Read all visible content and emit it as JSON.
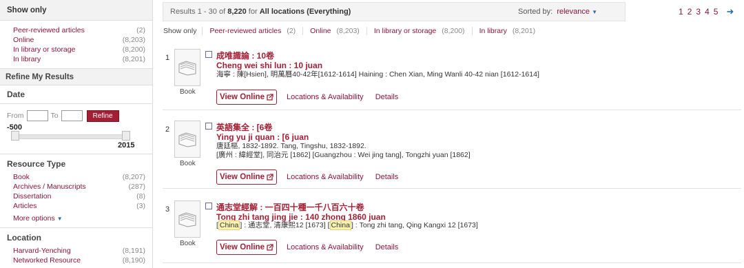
{
  "sidebar": {
    "show_only": {
      "title": "Show only",
      "items": [
        {
          "label": "Peer-reviewed articles",
          "count": "(2)"
        },
        {
          "label": "Online",
          "count": "(8,203)"
        },
        {
          "label": "In library or storage",
          "count": "(8,200)"
        },
        {
          "label": "In library",
          "count": "(8,201)"
        }
      ]
    },
    "refine_title": "Refine My Results",
    "date": {
      "title": "Date",
      "from_label": "From",
      "to_label": "To",
      "refine_button": "Refine",
      "min": "-500",
      "max": "2015"
    },
    "resource_type": {
      "title": "Resource Type",
      "items": [
        {
          "label": "Book",
          "count": "(8,207)"
        },
        {
          "label": "Archives / Manuscripts",
          "count": "(287)"
        },
        {
          "label": "Dissertation",
          "count": "(8)"
        },
        {
          "label": "Articles",
          "count": "(3)"
        }
      ],
      "more": "More options"
    },
    "location": {
      "title": "Location",
      "items": [
        {
          "label": "Harvard-Yenching",
          "count": "(8,191)"
        },
        {
          "label": "Networked Resource",
          "count": "(8,190)"
        }
      ]
    }
  },
  "topbar": {
    "results_prefix": "Results",
    "range": "1 - 30",
    "of": "of",
    "total": "8,220",
    "for": "for",
    "scope": "All locations (Everything)",
    "sorted_label": "Sorted by:",
    "sorted_value": "relevance",
    "pages": [
      "1",
      "2",
      "3",
      "4",
      "5"
    ]
  },
  "showonly": {
    "lead": "Show only",
    "items": [
      {
        "label": "Peer-reviewed articles",
        "count": "(2)"
      },
      {
        "label": "Online",
        "count": "(8,203)"
      },
      {
        "label": "In library or storage",
        "count": "(8,200)"
      },
      {
        "label": "In library",
        "count": "(8,201)"
      }
    ]
  },
  "results": [
    {
      "num": "1",
      "type": "Book",
      "title_cjk": "成唯識論 : 10卷",
      "title_rom": "Cheng wei shi lun : 10 juan",
      "meta1": "海寧 : 陳[Hsien], 明萬曆40-42年[1612-1614] Haining : Chen Xian, Ming Wanli 40-42 nian [1612-1614]",
      "view_online": "View Online",
      "locations": "Locations & Availability",
      "details": "Details"
    },
    {
      "num": "2",
      "type": "Book",
      "title_cjk": "英語集全 : [6卷",
      "title_rom": "Ying yu ji quan : [6 juan",
      "meta1": "唐廷樞, 1832-1892. Tang, Tingshu, 1832-1892.",
      "meta2": "[廣州 : 緯經堂], 同治元 [1862] [Guangzhou : Wei jing tang], Tongzhi yuan [1862]",
      "view_online": "View Online",
      "locations": "Locations & Availability",
      "details": "Details"
    },
    {
      "num": "3",
      "type": "Book",
      "title_cjk": "通志堂經解 : 一百四十種一千八百六十卷",
      "title_rom": "Tong zhi tang jing jie : 140 zhong 1860 juan",
      "meta_hl": "China",
      "meta_a": " : 通志堂, 清康熙12 [1673] ",
      "meta_b": " : Tong zhi tang, Qing Kangxi 12 [1673]",
      "view_online": "View Online",
      "locations": "Locations & Availability",
      "details": "Details"
    }
  ]
}
